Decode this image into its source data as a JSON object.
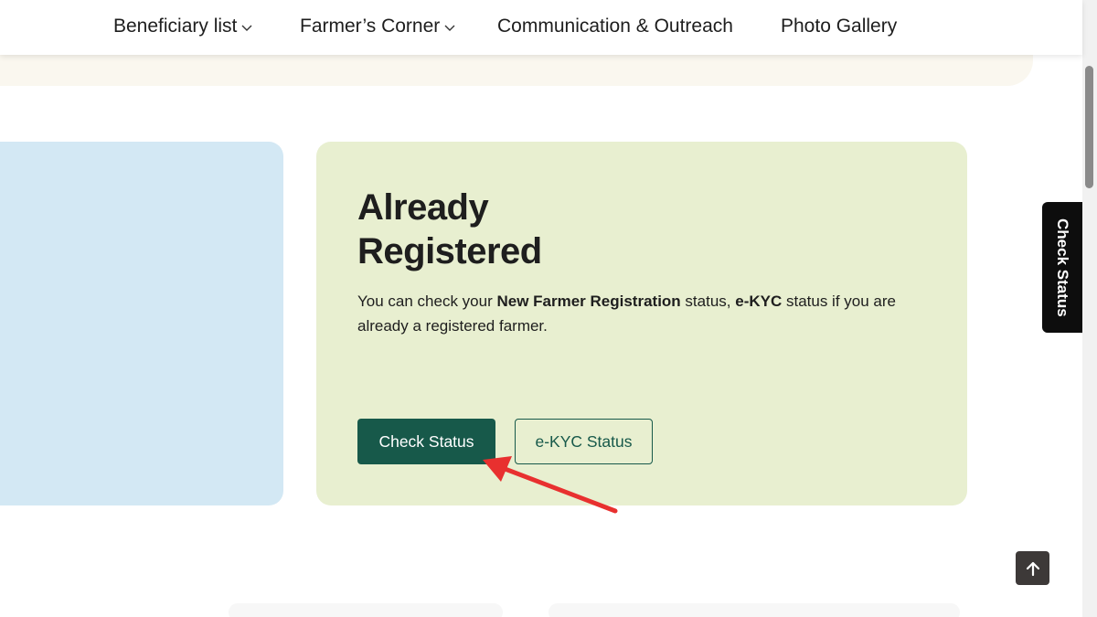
{
  "nav": {
    "items": [
      {
        "label": "Beneficiary list",
        "dropdown": true
      },
      {
        "label": "Farmer’s Corner",
        "dropdown": true
      },
      {
        "label": "Communication & Outreach",
        "dropdown": false
      },
      {
        "label": "Photo Gallery",
        "dropdown": false
      }
    ]
  },
  "card": {
    "title_line1": "Already",
    "title_line2": "Registered",
    "desc_part1": "You can check your ",
    "desc_bold1": "New Farmer Registration",
    "desc_part2": " status, ",
    "desc_bold2": "e-KYC",
    "desc_part3": " status if you are already a registered farmer.",
    "check_status_label": "Check Status",
    "ekyc_status_label": "e-KYC Status"
  },
  "side_tab": {
    "label": "Check Status"
  },
  "scroll_top": {
    "icon": "arrow-up-icon"
  },
  "colors": {
    "primary_green": "#17594a",
    "card_green_bg": "#e8efd0",
    "card_blue_bg": "#d3e8f4",
    "annotation_red": "#e8302f"
  }
}
